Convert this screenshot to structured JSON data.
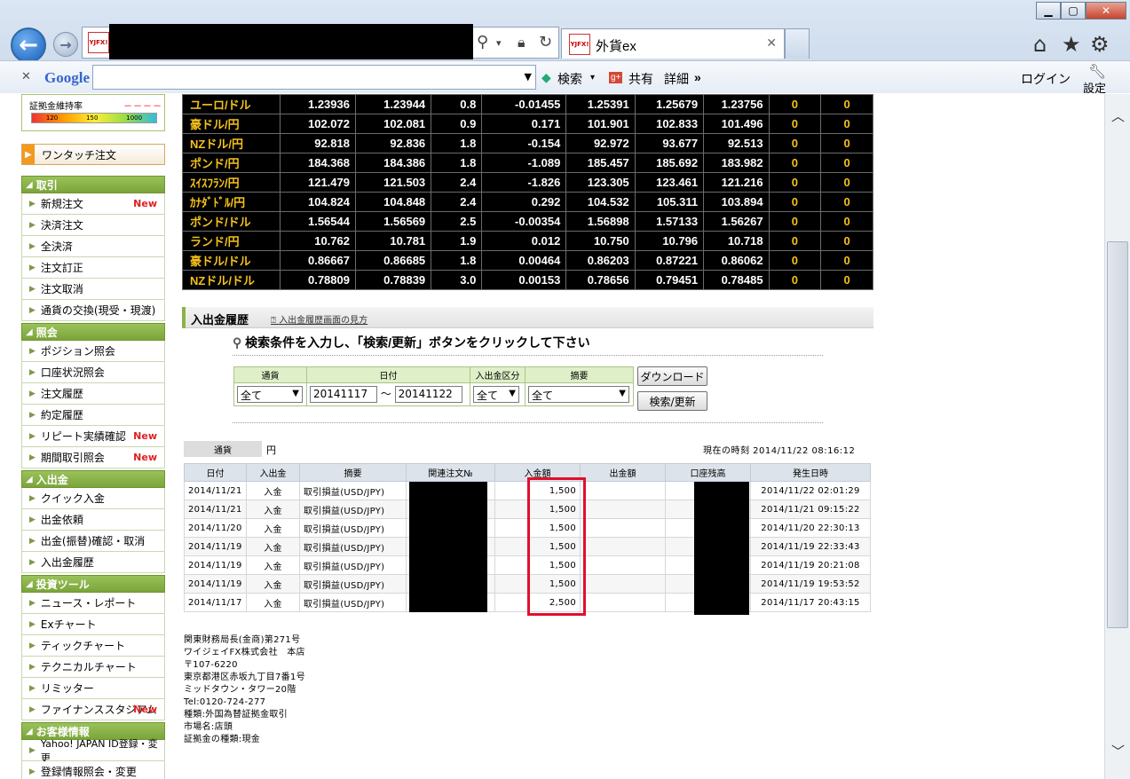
{
  "browser": {
    "tab_title": "外貨ex",
    "favicon_text": "YJFX!",
    "toolbar": {
      "search_label": "検索",
      "share_label": "共有",
      "detail_label": "詳細",
      "more": "»",
      "login": "ログイン",
      "settings": "設定",
      "google": "Google"
    },
    "icons": [
      "back-icon",
      "forward-icon",
      "search-icon",
      "lock-icon",
      "refresh-icon",
      "home-icon",
      "star-icon",
      "gear-icon"
    ]
  },
  "sidebar": {
    "margin_label": "証拠金維持率",
    "margin_dash": "－－－－",
    "margin_scale": [
      "120",
      "150",
      "1000"
    ],
    "one_touch": "ワンタッチ注文",
    "sections": [
      {
        "title": "取引",
        "items": [
          {
            "label": "新規注文",
            "new": "New"
          },
          {
            "label": "決済注文",
            "new": ""
          },
          {
            "label": "全決済",
            "new": ""
          },
          {
            "label": "注文訂正",
            "new": ""
          },
          {
            "label": "注文取消",
            "new": ""
          },
          {
            "label": "通貨の交換(現受・現渡)",
            "new": ""
          }
        ]
      },
      {
        "title": "照会",
        "items": [
          {
            "label": "ポジション照会",
            "new": ""
          },
          {
            "label": "口座状況照会",
            "new": ""
          },
          {
            "label": "注文履歴",
            "new": ""
          },
          {
            "label": "約定履歴",
            "new": ""
          },
          {
            "label": "リピート実績確認",
            "new": "New"
          },
          {
            "label": "期間取引照会",
            "new": "New"
          }
        ]
      },
      {
        "title": "入出金",
        "items": [
          {
            "label": "クイック入金",
            "new": ""
          },
          {
            "label": "出金依頼",
            "new": ""
          },
          {
            "label": "出金(振替)確認・取消",
            "new": ""
          },
          {
            "label": "入出金履歴",
            "new": ""
          }
        ]
      },
      {
        "title": "投資ツール",
        "items": [
          {
            "label": "ニュース・レポート",
            "new": ""
          },
          {
            "label": "Exチャート",
            "new": ""
          },
          {
            "label": "ティックチャート",
            "new": ""
          },
          {
            "label": "テクニカルチャート",
            "new": ""
          },
          {
            "label": "リミッター",
            "new": ""
          },
          {
            "label": "ファイナンススタジアム",
            "new": "New"
          }
        ]
      },
      {
        "title": "お客様情報",
        "items": [
          {
            "label": "Yahoo! JAPAN ID登録・変更",
            "new": ""
          },
          {
            "label": "登録情報照会・変更",
            "new": ""
          }
        ]
      }
    ]
  },
  "rates": [
    [
      "ユーロ/ドル",
      "1.23936",
      "1.23944",
      "0.8",
      "-0.01455",
      "1.25391",
      "1.25679",
      "1.23756",
      "0",
      "0"
    ],
    [
      "豪ドル/円",
      "102.072",
      "102.081",
      "0.9",
      "0.171",
      "101.901",
      "102.833",
      "101.496",
      "0",
      "0"
    ],
    [
      "NZドル/円",
      "92.818",
      "92.836",
      "1.8",
      "-0.154",
      "92.972",
      "93.677",
      "92.513",
      "0",
      "0"
    ],
    [
      "ポンド/円",
      "184.368",
      "184.386",
      "1.8",
      "-1.089",
      "185.457",
      "185.692",
      "183.982",
      "0",
      "0"
    ],
    [
      "ｽｲｽﾌﾗﾝ/円",
      "121.479",
      "121.503",
      "2.4",
      "-1.826",
      "123.305",
      "123.461",
      "121.216",
      "0",
      "0"
    ],
    [
      "ｶﾅﾀﾞﾄﾞﾙ/円",
      "104.824",
      "104.848",
      "2.4",
      "0.292",
      "104.532",
      "105.311",
      "103.894",
      "0",
      "0"
    ],
    [
      "ポンド/ドル",
      "1.56544",
      "1.56569",
      "2.5",
      "-0.00354",
      "1.56898",
      "1.57133",
      "1.56267",
      "0",
      "0"
    ],
    [
      "ランド/円",
      "10.762",
      "10.781",
      "1.9",
      "0.012",
      "10.750",
      "10.796",
      "10.718",
      "0",
      "0"
    ],
    [
      "豪ドル/ドル",
      "0.86667",
      "0.86685",
      "1.8",
      "0.00464",
      "0.86203",
      "0.87221",
      "0.86062",
      "0",
      "0"
    ],
    [
      "NZドル/ドル",
      "0.78809",
      "0.78839",
      "3.0",
      "0.00153",
      "0.78656",
      "0.79451",
      "0.78485",
      "0",
      "0"
    ]
  ],
  "history": {
    "title": "入出金履歴",
    "help_link": "入出金履歴画面の見方",
    "search_message": "検索条件を入力し、「検索/更新」ボタンをクリックして下さい",
    "form": {
      "headers": [
        "通貨",
        "日付",
        "入出金区分",
        "摘要"
      ],
      "currency": "全て",
      "date_from": "20141117",
      "tilde": "～",
      "date_to": "20141122",
      "type": "全て",
      "summary": "全て",
      "download": "ダウンロード",
      "search": "検索/更新"
    },
    "currency_label": "通貨",
    "currency_value": "円",
    "now_time": "現在の時刻 2014/11/22 08:16:12",
    "columns": [
      "日付",
      "入出金",
      "摘要",
      "関連注文№",
      "入金額",
      "出金額",
      "口座残高",
      "発生日時"
    ],
    "rows": [
      [
        "2014/11/21",
        "入金",
        "取引損益(USD/JPY)",
        "",
        "1,500",
        "",
        "",
        "2014/11/22 02:01:29"
      ],
      [
        "2014/11/21",
        "入金",
        "取引損益(USD/JPY)",
        "",
        "1,500",
        "",
        "",
        "2014/11/21 09:15:22"
      ],
      [
        "2014/11/20",
        "入金",
        "取引損益(USD/JPY)",
        "",
        "1,500",
        "",
        "",
        "2014/11/20 22:30:13"
      ],
      [
        "2014/11/19",
        "入金",
        "取引損益(USD/JPY)",
        "",
        "1,500",
        "",
        "",
        "2014/11/19 22:33:43"
      ],
      [
        "2014/11/19",
        "入金",
        "取引損益(USD/JPY)",
        "",
        "1,500",
        "",
        "",
        "2014/11/19 20:21:08"
      ],
      [
        "2014/11/19",
        "入金",
        "取引損益(USD/JPY)",
        "",
        "1,500",
        "",
        "",
        "2014/11/19 19:53:52"
      ],
      [
        "2014/11/17",
        "入金",
        "取引損益(USD/JPY)",
        "",
        "2,500",
        "",
        "",
        "2014/11/17 20:43:15"
      ]
    ]
  },
  "footer": [
    "関東財務局長(金商)第271号",
    "ワイジェイFX株式会社　本店",
    "〒107-6220",
    "東京都港区赤坂九丁目7番1号",
    "ミッドタウン・タワー20階",
    "Tel:0120-724-277",
    "種類:外国為替証拠金取引",
    "市場名:店頭",
    "証拠金の種類:現金"
  ],
  "colors": {
    "accent_green": "#8cb347",
    "rate_text": "#f4c11b",
    "highlight": "#e0102b",
    "new_badge": "#e02020"
  }
}
